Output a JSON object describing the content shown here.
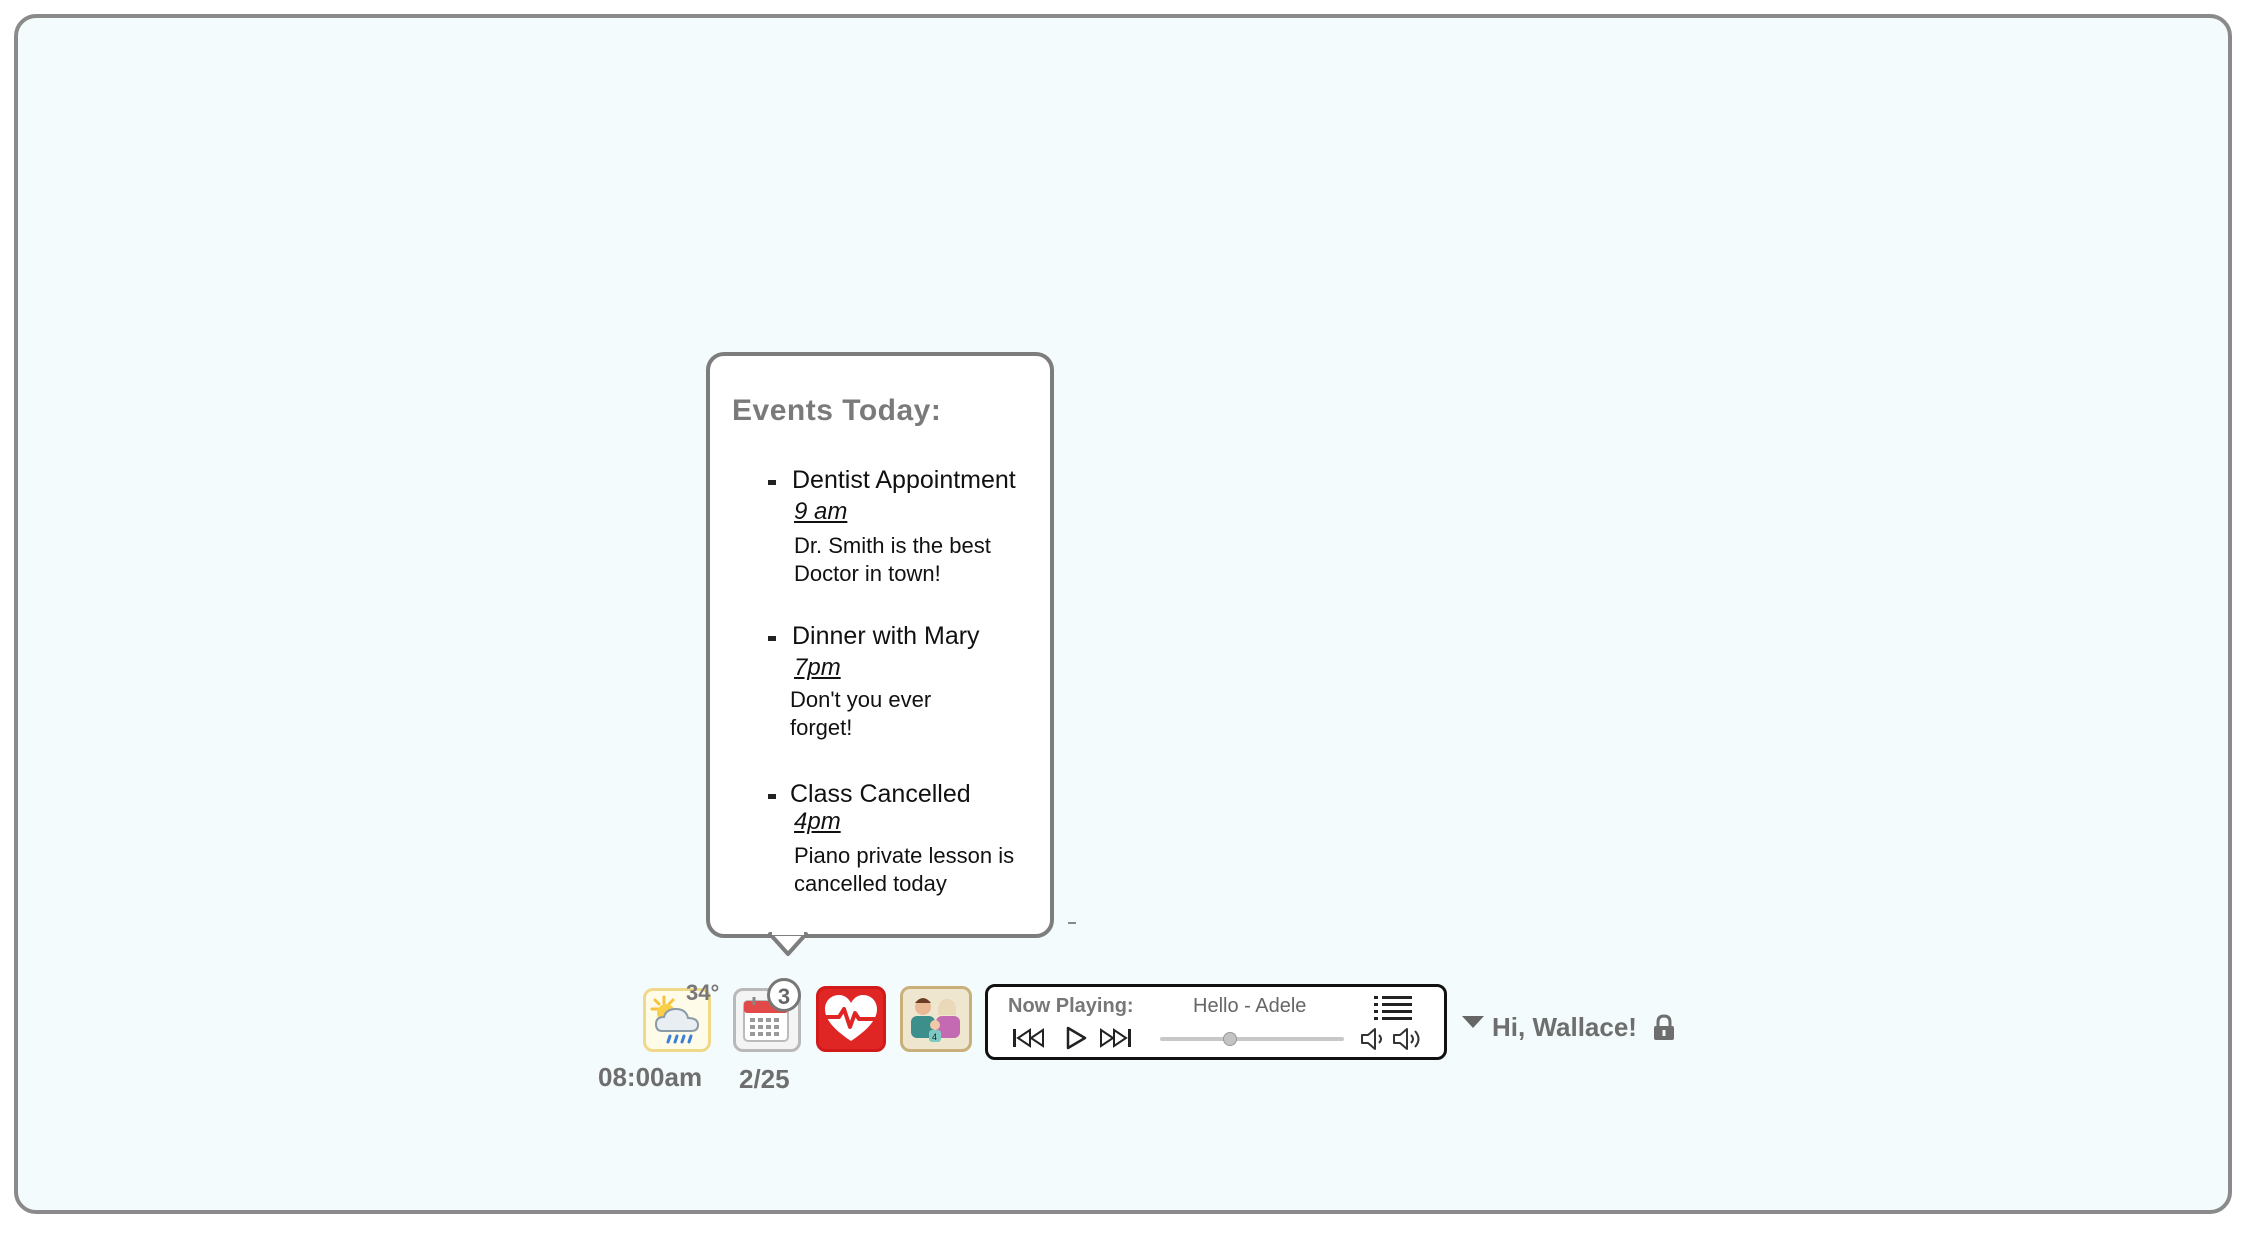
{
  "events_popup": {
    "title": "Events Today:",
    "events": [
      {
        "title": "Dentist Appointment",
        "time": "9 am",
        "desc": "Dr. Smith is the best Doctor in town!"
      },
      {
        "title": "Dinner with Mary",
        "time": "7pm",
        "desc": "Don't you ever forget!"
      },
      {
        "title": "Class Cancelled",
        "time": "4pm",
        "desc": "Piano private lesson is cancelled today"
      }
    ]
  },
  "dock": {
    "weather": {
      "temperature": "34°",
      "icon": "sun-cloud-rain-icon"
    },
    "calendar": {
      "badge_count": "3",
      "icon": "calendar-icon"
    },
    "health": {
      "icon": "heart-pulse-icon"
    },
    "family": {
      "icon": "family-icon"
    },
    "clock": "08:00am",
    "date": "2/25"
  },
  "player": {
    "now_playing_label": "Now Playing:",
    "track": "Hello - Adele",
    "progress": 0.38
  },
  "user": {
    "greeting": "Hi, Wallace!"
  },
  "colors": {
    "frame_border": "#8a8a8a",
    "background": "#f3fbfc",
    "health_red": "#e02525",
    "weather_border": "#f0d889"
  }
}
